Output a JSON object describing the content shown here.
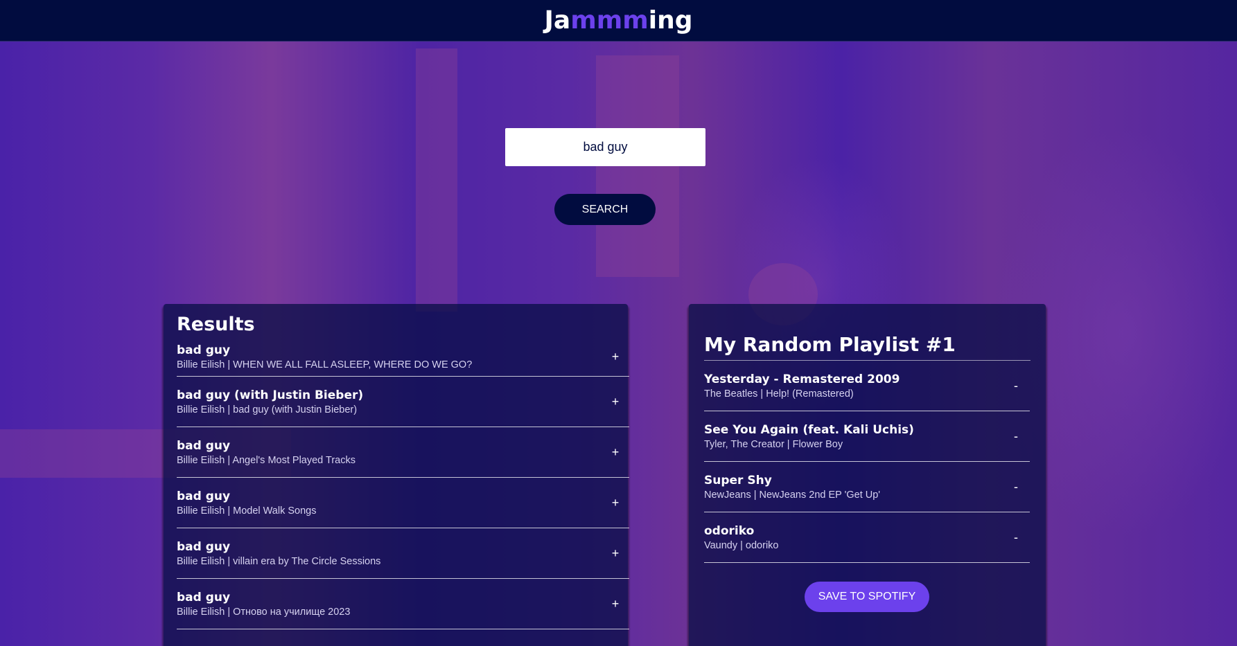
{
  "app": {
    "logo_prefix": "Ja",
    "logo_accent": "mmm",
    "logo_suffix": "ing"
  },
  "colors": {
    "header_bg": "#010c3f",
    "accent": "#6c41ec",
    "panel_bg": "#010c3f"
  },
  "search": {
    "value": "bad guy",
    "button_label": "SEARCH"
  },
  "results": {
    "title": "Results",
    "action_icon": "plus-icon",
    "action_label": "+",
    "tracks": [
      {
        "name": "bad guy",
        "sub": "Billie Eilish | WHEN WE ALL FALL ASLEEP, WHERE DO WE GO?"
      },
      {
        "name": "bad guy (with Justin Bieber)",
        "sub": "Billie Eilish | bad guy (with Justin Bieber)"
      },
      {
        "name": "bad guy",
        "sub": "Billie Eilish | Angel's Most Played Tracks"
      },
      {
        "name": "bad guy",
        "sub": "Billie Eilish | Model Walk Songs"
      },
      {
        "name": "bad guy",
        "sub": "Billie Eilish | villain era by The Circle Sessions"
      },
      {
        "name": "bad guy",
        "sub": "Billie Eilish | Отново на училище 2023"
      }
    ]
  },
  "playlist": {
    "title": "My Random Playlist #1",
    "action_icon": "minus-icon",
    "action_label": "-",
    "save_label": "SAVE TO SPOTIFY",
    "tracks": [
      {
        "name": "Yesterday - Remastered 2009",
        "sub": "The Beatles | Help! (Remastered)"
      },
      {
        "name": "See You Again (feat. Kali Uchis)",
        "sub": "Tyler, The Creator | Flower Boy"
      },
      {
        "name": "Super Shy",
        "sub": "NewJeans | NewJeans 2nd EP 'Get Up'"
      },
      {
        "name": "odoriko",
        "sub": "Vaundy | odoriko"
      }
    ]
  }
}
